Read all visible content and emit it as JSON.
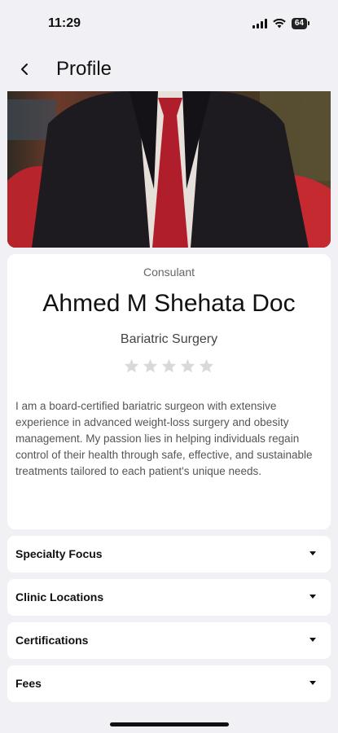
{
  "status_bar": {
    "time": "11:29",
    "battery": "64"
  },
  "header": {
    "title": "Profile"
  },
  "profile": {
    "consultant_label": "Consulant",
    "name": "Ahmed M Shehata Doc",
    "specialty": "Bariatric Surgery",
    "rating": 0,
    "rating_max": 5,
    "bio": "I am a board-certified bariatric surgeon with extensive experience in advanced weight-loss surgery and obesity management. My passion lies in helping individuals regain control of their health through safe, effective, and sustainable treatments tailored to each patient's unique needs."
  },
  "sections": [
    {
      "label": "Specialty Focus"
    },
    {
      "label": "Clinic Locations"
    },
    {
      "label": "Certifications"
    },
    {
      "label": "Fees"
    }
  ],
  "colors": {
    "background": "#f1f1f5",
    "card": "#ffffff",
    "star_empty": "#d9d9d9"
  }
}
